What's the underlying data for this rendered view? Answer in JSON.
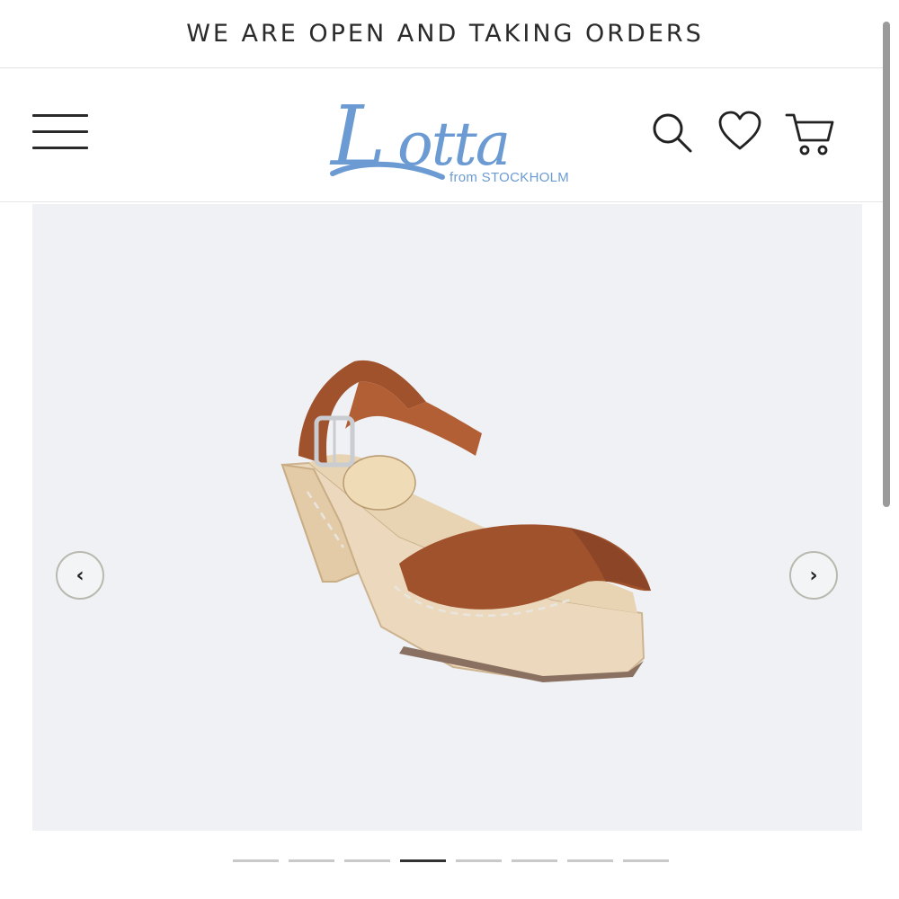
{
  "announcement": {
    "text": "WE ARE OPEN AND TAKING ORDERS"
  },
  "header": {
    "logo_text": "Lotta",
    "logo_subtext": "from STOCKHOLM",
    "icons": [
      "menu-icon",
      "search-icon",
      "heart-icon",
      "cart-icon"
    ]
  },
  "gallery": {
    "prev_label": "‹",
    "next_label": "›",
    "slide_count": 8,
    "active_slide": 4,
    "image_subject": "brown leather clog sandal with wooden heel"
  },
  "colors": {
    "brand_blue": "#6b9bd2",
    "gallery_bg": "#eff1f4",
    "leather": "#a0522d",
    "wood": "#ecd9bd"
  }
}
